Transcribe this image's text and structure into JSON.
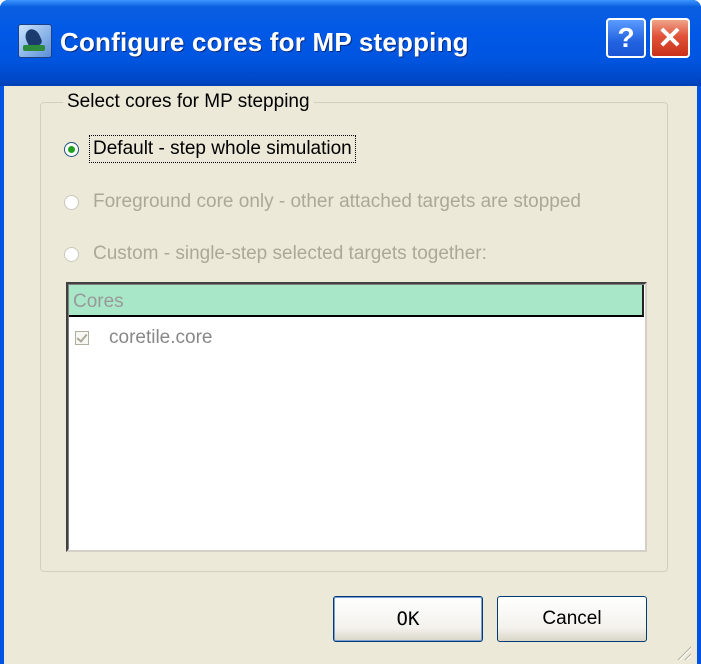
{
  "window": {
    "title": "Configure cores for MP stepping",
    "help_glyph": "?",
    "close_glyph": "✕"
  },
  "group": {
    "legend": "Select cores for MP stepping",
    "options": [
      {
        "label": "Default - step whole simulation",
        "selected": true,
        "enabled": true
      },
      {
        "label": "Foreground core only - other attached targets are stopped",
        "selected": false,
        "enabled": false
      },
      {
        "label": "Custom - single-step selected targets together:",
        "selected": false,
        "enabled": false
      }
    ]
  },
  "cores_list": {
    "header": "Cores",
    "items": [
      {
        "label": "coretile.core",
        "checked": true,
        "enabled": false
      }
    ]
  },
  "buttons": {
    "ok": "OK",
    "cancel": "Cancel"
  },
  "icons": {
    "app": "app-icon",
    "help": "help-icon",
    "close": "close-icon"
  }
}
